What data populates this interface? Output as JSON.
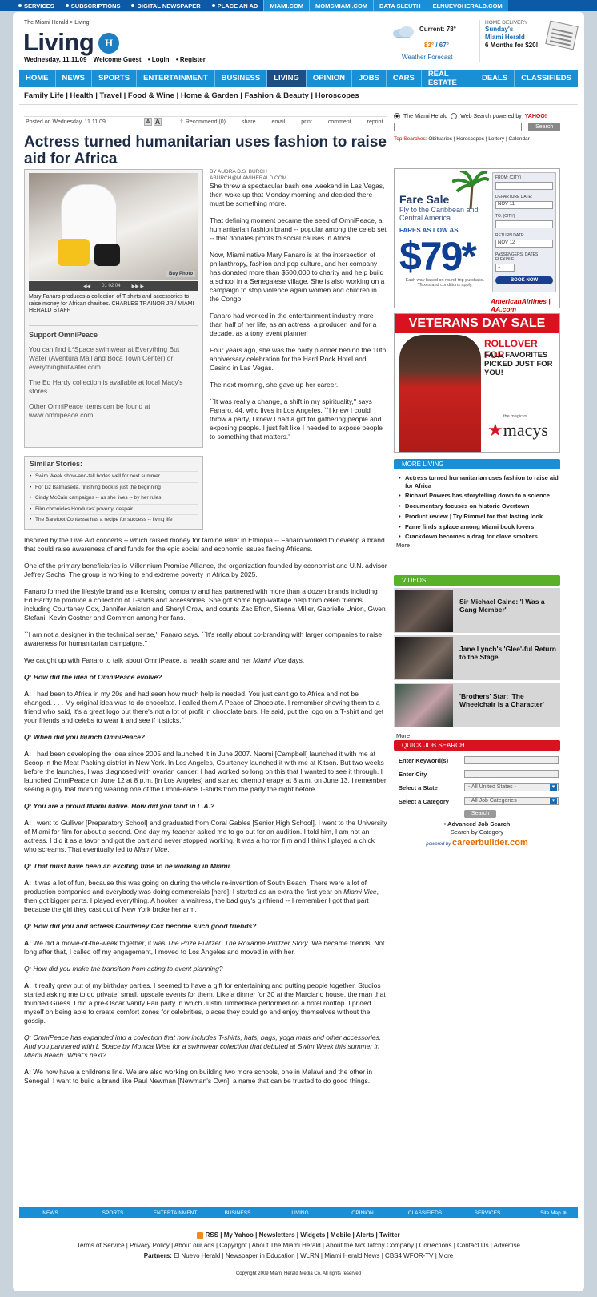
{
  "topbar": {
    "items": [
      "SERVICES",
      "SUBSCRIPTIONS",
      "DIGITAL NEWSPAPER",
      "PLACE AN AD"
    ],
    "sites": [
      "MIAMI.COM",
      "MOMSMIAMI.COM",
      "DATA SLEUTH",
      "ELNUEVOHERALD.COM"
    ]
  },
  "header": {
    "breadcrumb": "The Miami Herald > Living",
    "section": "Living",
    "logo_letter": "H",
    "date": "Wednesday, 11.11.09",
    "welcome": "Welcome Guest",
    "login": "Login",
    "register": "Register"
  },
  "weather": {
    "current": "Current: 78°",
    "high": "83°",
    "low": "/ 67°",
    "forecast": "Weather Forecast"
  },
  "delivery": {
    "label": "HOME DELIVERY",
    "line1": "Sunday's",
    "line2": "Miami Herald",
    "price": "6 Months for $20!",
    "badge": "EXTRA"
  },
  "nav": [
    "HOME",
    "NEWS",
    "SPORTS",
    "ENTERTAINMENT",
    "BUSINESS",
    "LIVING",
    "OPINION",
    "JOBS",
    "CARS",
    "REAL ESTATE",
    "DEALS",
    "CLASSIFIEDS"
  ],
  "subnav": "Family Life | Health | Travel | Food & Wine | Home & Garden | Fashion & Beauty | Horoscopes",
  "toolbar": {
    "posted": "Posted on Wednesday, 11.11.09",
    "a_small": "A",
    "a_big": "A",
    "recommend": "Recommend (0)",
    "share": "share",
    "email": "email",
    "print": "print",
    "comment": "comment",
    "reprint": "reprint"
  },
  "article": {
    "title": "Actress turned humanitarian uses fashion to raise aid for Africa",
    "byline": "BY AUDRA D.S. BURCH",
    "email": "ABURCH@MIAMIHERALD.COM",
    "photo_buy": "Buy Photo",
    "photo_pages": "01 02 04",
    "caption": "Mary Fanaro produces a collection of T-shirts and accessories to raise money for African charities. CHARLES TRAINOR JR / MIAMI HERALD STAFF",
    "support_title": "Support OmniPeace",
    "support": [
      "You can find L*Space swimwear at Everything But Water (Aventura Mall and Boca Town Center) or everythingbutwater.com.",
      "The Ed Hardy collection is available at local Macy's stores.",
      "Other OmniPeace items can be found at www.omnipeace.com"
    ],
    "similar_title": "Similar Stories:",
    "similar": [
      "Swim Week show-and-tell bodes well for next summer",
      "For Liz Balmaseda, finishing book is just the beginning",
      "Cindy McCain campaigns -- as she lives -- by her rules",
      "Film chronicles Honduras' poverty, despair",
      "The Barefoot Contessa has a recipe for success -- living life"
    ],
    "col": [
      "She threw a spectacular bash one weekend in Las Vegas, then woke up that Monday morning and decided there must be something more.",
      "That defining moment became the seed of OmniPeace, a humanitarian fashion brand -- popular among the celeb set -- that donates profits to social causes in Africa.",
      "Now, Miami native Mary Fanaro is at the intersection of philanthropy, fashion and pop culture, and her company has donated more than $500,000 to charity and help build a school in a Senegalese village. She is also working on a campaign to stop violence again women and children in the Congo.",
      "Fanaro had worked in the entertainment industry more than half of her life, as an actress, a producer, and for a decade, as a tony event planner.",
      "Four years ago, she was the party planner behind the 10th anniversary celebration for the Hard Rock Hotel and Casino in Las Vegas.",
      "The next morning, she gave up her career.",
      "``It was really a change, a shift in my spirituality,'' says Fanaro, 44, who lives in Los Angeles. ``I knew I could throw a party, I knew I had a gift for gathering people and exposing people. I just felt like I needed to expose people to something that matters.''"
    ],
    "p1": "Inspired by the Live Aid concerts -- which raised money for famine relief in Ethiopia -- Fanaro worked to develop a brand that could raise awareness of and funds for the epic social and economic issues facing Africans.",
    "p2": "One of the primary beneficiaries is Millennium Promise Alliance, the organization founded by economist and U.N. advisor Jeffrey Sachs. The group is working to end extreme poverty in Africa by 2025.",
    "p3": "Fanaro formed the lifestyle brand as a licensing company and has partnered with more than a dozen brands including Ed Hardy to produce a collection of T-shirts and accessories. She got some high-wattage help from celeb friends including Courteney Cox, Jennifer Aniston and Sheryl Crow, and counts Zac Efron, Sienna Miller, Gabrielle Union, Gwen Stefani, Kevin Costner and Common among her fans.",
    "p4": "``I am not a designer in the technical sense,'' Fanaro says. ``It's really about co-branding with larger companies to raise awareness for humanitarian campaigns.''",
    "p5a": "We caught up with Fanaro to talk about OmniPeace, a health scare and her ",
    "p5b": "Miami Vice",
    "p5c": " days.",
    "q1": "Q: How did the idea of OmniPeace evolve?",
    "a1": "I had been to Africa in my 20s and had seen how much help is needed. You just can't go to Africa and not be changed. . . . My original idea was to do chocolate. I called them A Peace of Chocolate. I remember showing them to a friend who said, it's a great logo but there's not a lot of profit in chocolate bars. He said, put the logo on a T-shirt and get your friends and celebs to wear it and see if it sticks.''",
    "q2": "Q: When did you launch OmniPeace?",
    "a2": "I had been developing the idea since 2005 and launched it in June 2007. Naomi [Campbell] launched it with me at Scoop in the Meat Packing district in New York. In Los Angeles, Courteney launched it with me at Kitson. But two weeks before the launches, I was diagnosed with ovarian cancer. I had worked so long on this that I wanted to see it through. I launched OmniPeace on June 12 at 8 p.m. [in Los Angeles] and started chemotherapy at 8 a.m. on June 13. I remember seeing a guy that morning wearing one of the OmniPeace T-shirts from the party the night before.",
    "q3": "Q: You are a proud Miami native. How did you land in L.A.?",
    "a3a": "I went to Gulliver [Preparatory School] and graduated from Coral Gables [Senior High School]. I went to the University of Miami for film for about a second. One day my teacher asked me to go out for an audition. I told him, I am not an actress. I did it as a favor and got the part and never stopped working. It was a horror film and I think I played a chick who screams. That eventually led to ",
    "a3b": "Miami Vice",
    "q4": "Q: That must have been an exciting time to be working in Miami.",
    "a4a": "It was a lot of fun, because this was going on during the whole re-invention of South Beach. There were a lot of production companies and everybody was doing commercials [here]. I started as an extra the first year on ",
    "a4b": "Miami Vice",
    ", then got bigger parts. I played everything. A hooker, a waitress, the bad guy's girlfriend -- I remember I got that part because the girl they cast out of New York broke her arm.": "",
    "a4c": ", then got bigger parts. I played everything. A hooker, a waitress, the bad guy's girlfriend -- I remember I got that part because the girl they cast out of New York broke her arm.",
    "q5": "Q: How did you and actress Courteney Cox become such good friends?",
    "a5a": "We did a movie-of-the-week together, it was ",
    "a5b": "The Prize Pulitzer: The Roxanne Pulitzer Story",
    "a5c": ". We became friends. Not long after that, I called off my engagement, I moved to Los Angeles and moved in with her.",
    "q6": "Q: How did you make the transition from acting to event planning?",
    "a6": "It really grew out of my birthday parties. I seemed to have a gift for entertaining and putting people together. Studios started asking me to do private, small, upscale events for them. Like a dinner for 30 at the Marciano house, the man that founded Guess. I did a pre-Oscar Vanity Fair party in which Justin Timberlake performed on a hotel rooftop. I prided myself on being able to create comfort zones for celebrities, places they could go and enjoy themselves without the gossip.",
    "q7": "Q: OmniPeace has expanded into a collection that now includes T-shirts, hats, bags, yoga mats and other accessories. And you partnered with L Space by Monica Wise for a swimwear collection that debuted at Swim Week this summer in Miami Beach. What's next?",
    "a7": "We now have a children's line. We are also working on building two more schools, one in Malawi and the other in Senegal. I want to build a brand like Paul Newman [Newman's Own], a name that can be trusted to do good things.",
    "a_label": "A:"
  },
  "search": {
    "opt1": "The Miami Herald",
    "opt2": "Web Search powered by",
    "yahoo": "YAHOO!",
    "button": "Search",
    "top_label": "Top Searches:",
    "top": "Obituaries | Horoscopes | Lottery | Calendar"
  },
  "ad_aa": {
    "fare": "Fare Sale",
    "fly": "Fly to the Caribbean and Central America.",
    "fares": "FARES AS LOW AS",
    "price": "$79*",
    "note": "Each way based on round-trip purchase. *Taxes and conditions apply.",
    "brand": "AmericanAirlines | AA.com",
    "from": "FROM: (CITY)",
    "dep": "DEPARTURE DATE:",
    "to": "TO: (CITY)",
    "ret": "RETURN DATE:",
    "pax": "PASSENGERS:",
    "flex": "DATES FLEXIBLE:",
    "book": "BOOK NOW",
    "nov": "NOV",
    "d1": "11",
    "d2": "12",
    "p1": "1"
  },
  "ad_macys": {
    "head": "VETERANS DAY SALE",
    "rollover": "ROLLOVER FOR",
    "fall": "FALL FAVORITES PICKED JUST FOR YOU!",
    "magic": "the magic of",
    "brand": "macys",
    "url": "macys.com"
  },
  "more_living": {
    "title": "MORE LIVING",
    "items": [
      "Actress turned humanitarian uses fashion to raise aid for Africa",
      "Richard Powers has storytelling down to a science",
      "Documentary focuses on historic Overtown",
      "Product review | Try Rimmel for that lasting look",
      "Fame finds a place among Miami book lovers",
      "Crackdown becomes a drag for clove smokers"
    ],
    "more": "More"
  },
  "videos": {
    "title": "VIDEOS",
    "items": [
      "Sir Michael Caine: 'I Was a Gang Member'",
      "Jane Lynch's 'Glee'-ful Return to the Stage",
      "'Brothers' Star: 'The Wheelchair is a Character'"
    ],
    "more": "More"
  },
  "jobs": {
    "title": "QUICK JOB SEARCH",
    "kw": "Enter Keyword(s)",
    "city": "Enter City",
    "state": "Select a State",
    "state_val": "- All United States -",
    "cat": "Select a Category",
    "cat_val": "- All Job Categories -",
    "button": "Search",
    "adv": "Advanced Job Search",
    "bycat": "Search by Category",
    "powered": "powered by",
    "cb": "careerbuilder.com"
  },
  "footer": {
    "nav": [
      "NEWS",
      "SPORTS",
      "ENTERTAINMENT",
      "BUSINESS",
      "LIVING",
      "OPINION",
      "CLASSIFIEDS",
      "SERVICES"
    ],
    "sitemap": "Site Map",
    "line1": "RSS | My Yahoo | Newsletters | Widgets | Mobile | Alerts | Twitter",
    "line2": "Terms of Service | Privacy Policy | About our ads | Copyright | About The Miami Herald | About the McClatchy Company | Corrections | Contact Us | Advertise",
    "partners_label": "Partners:",
    "partners": "El Nuevo Herald | Newspaper in Education | WLRN | Miami Herald News | CBS4 WFOR-TV | More",
    "copyright": "Copyright 2009 Miami Herald Media Co. All rights reserved"
  },
  "colors": {
    "nav_blue": "#1a8fd6",
    "nav_active": "#1c4f86",
    "title": "#1d2b44",
    "green": "#59b12a",
    "red": "#d8121f"
  }
}
